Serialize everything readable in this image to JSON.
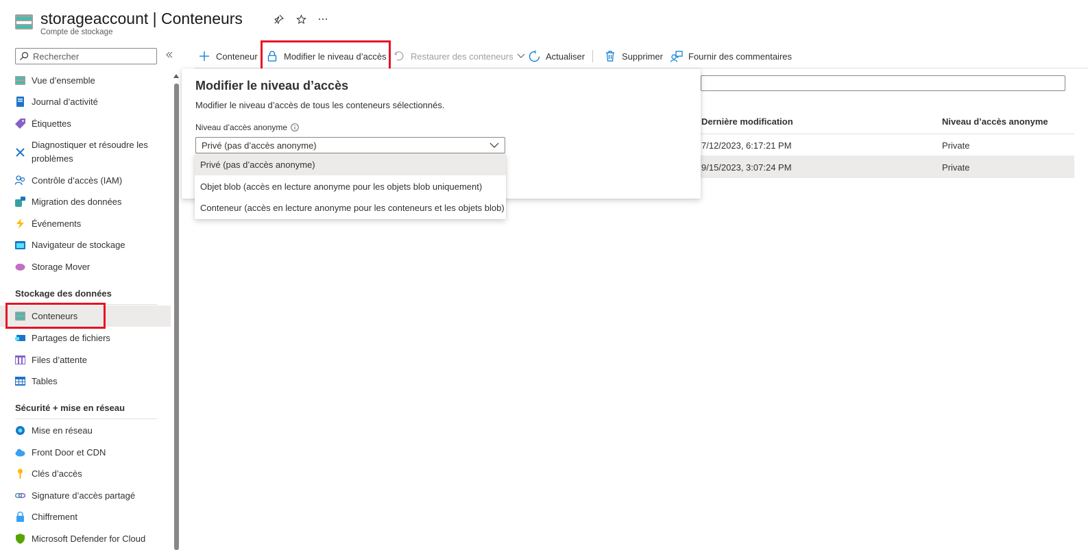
{
  "header": {
    "title": "storageaccount | Conteneurs",
    "subtitle": "Compte de stockage"
  },
  "sidebar": {
    "search_placeholder": "Rechercher",
    "items": [
      {
        "label": "Vue d’ensemble",
        "icon": "overview-icon"
      },
      {
        "label": "Journal d’activité",
        "icon": "activity-log-icon"
      },
      {
        "label": "Étiquettes",
        "icon": "tag-icon"
      },
      {
        "label": "Diagnostiquer et résoudre les",
        "label2": "problèmes",
        "icon": "diagnose-icon"
      },
      {
        "label": "Contrôle d’accès (IAM)",
        "icon": "iam-icon"
      },
      {
        "label": "Migration des données",
        "icon": "migration-icon"
      },
      {
        "label": "Événements",
        "icon": "lightning-icon"
      },
      {
        "label": "Navigateur de stockage",
        "icon": "storage-browser-icon"
      },
      {
        "label": "Storage Mover",
        "icon": "storage-mover-icon"
      }
    ],
    "sections": [
      {
        "title": "Stockage des données",
        "items": [
          {
            "label": "Conteneurs",
            "icon": "containers-icon",
            "selected": true
          },
          {
            "label": "Partages de fichiers",
            "icon": "file-shares-icon"
          },
          {
            "label": "Files d’attente",
            "icon": "queues-icon"
          },
          {
            "label": "Tables",
            "icon": "tables-icon"
          }
        ]
      },
      {
        "title": "Sécurité + mise en réseau",
        "items": [
          {
            "label": "Mise en réseau",
            "icon": "networking-icon"
          },
          {
            "label": "Front Door et CDN",
            "icon": "cdn-icon"
          },
          {
            "label": "Clés d’accès",
            "icon": "key-icon"
          },
          {
            "label": "Signature d’accès partagé",
            "icon": "sas-icon"
          },
          {
            "label": "Chiffrement",
            "icon": "encryption-icon"
          },
          {
            "label": "Microsoft Defender for Cloud",
            "icon": "defender-icon"
          }
        ]
      }
    ]
  },
  "toolbar": {
    "add_container": "Conteneur",
    "change_access": "Modifier le niveau d’accès",
    "restore": "Restaurer des conteneurs",
    "refresh": "Actualiser",
    "delete": "Supprimer",
    "feedback": "Fournir des commentaires"
  },
  "table": {
    "columns": [
      "Dernière modification",
      "Niveau d’accès anonyme"
    ],
    "rows": [
      {
        "modified": "7/12/2023, 6:17:21 PM",
        "access": "Private",
        "selected": false
      },
      {
        "modified": "9/15/2023, 3:07:24 PM",
        "access": "Private",
        "selected": true
      }
    ]
  },
  "panel": {
    "title": "Modifier le niveau d’accès",
    "description": "Modifier le niveau d’accès de tous les conteneurs sélectionnés.",
    "field_label": "Niveau d’accès anonyme",
    "selected_value": "Privé (pas d’accès anonyme)",
    "options": [
      "Privé (pas d’accès anonyme)",
      "Objet blob (accès en lecture anonyme pour les objets blob uniquement)",
      "Conteneur (accès en lecture anonyme pour les conteneurs et les objets blob)"
    ]
  },
  "colors": {
    "accent": "#0078d4",
    "highlight": "#e81123",
    "selected_bg": "#edebe9"
  }
}
